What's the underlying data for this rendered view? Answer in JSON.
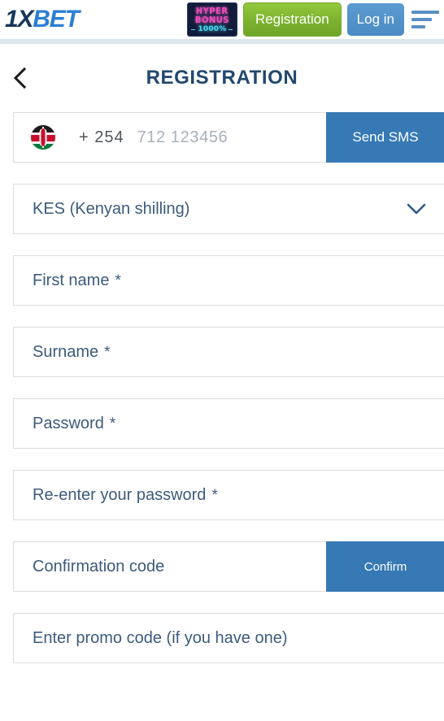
{
  "header": {
    "logo": {
      "part1": "1X",
      "part2": "BET"
    },
    "hyper_bonus": {
      "line1": "HYPER",
      "line2": "BONUS",
      "line3": "1000%"
    },
    "registration_label": "Registration",
    "login_label": "Log in",
    "menu_icon": "hamburger-menu-icon"
  },
  "titlebar": {
    "back_icon": "chevron-left-icon",
    "title": "REGISTRATION"
  },
  "form": {
    "phone": {
      "flag": "kenya-flag-icon",
      "dial_code": "+ 254",
      "placeholder": "712 123456",
      "button_label": "Send SMS"
    },
    "currency": {
      "value": "KES (Kenyan shilling)",
      "chevron_icon": "chevron-down-icon"
    },
    "first_name": {
      "label": "First name",
      "required_mark": "*"
    },
    "surname": {
      "label": "Surname",
      "required_mark": "*"
    },
    "password": {
      "label": "Password",
      "required_mark": "*"
    },
    "confirm_password": {
      "label": "Re-enter your password",
      "required_mark": "*"
    },
    "confirmation_code": {
      "placeholder": "Confirmation code",
      "button_label": "Confirm"
    },
    "promo_code": {
      "placeholder": "Enter promo code (if you have one)"
    }
  },
  "colors": {
    "accent_blue": "#3679b5",
    "brand_green": "#7cb22e",
    "title_navy": "#22486f",
    "label_blue": "#3d5a7d",
    "header_divider": "#dde5ed"
  }
}
